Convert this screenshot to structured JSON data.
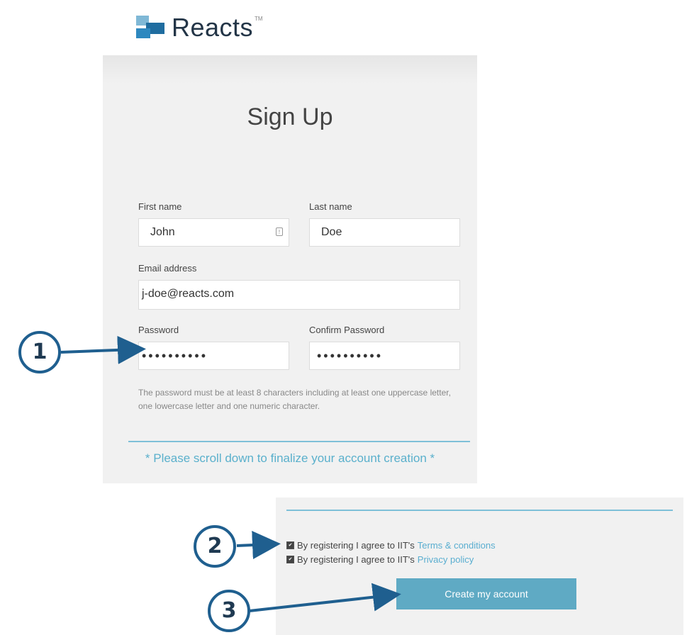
{
  "logo": {
    "name": "Reacts",
    "tm": "TM"
  },
  "form": {
    "title": "Sign Up",
    "first_name": {
      "label": "First name",
      "value": "John"
    },
    "last_name": {
      "label": "Last name",
      "value": "Doe"
    },
    "email": {
      "label": "Email address",
      "value": "j-doe@reacts.com"
    },
    "password": {
      "label": "Password",
      "value": "••••••••••"
    },
    "confirm_password": {
      "label": "Confirm Password",
      "value": "••••••••••"
    },
    "password_hint": "The password must be at least 8 characters including at least one uppercase letter, one lowercase letter and one numeric character.",
    "scroll_note": "* Please scroll down to finalize your account creation *"
  },
  "agreements": {
    "terms": {
      "text": "By registering I agree to IIT's",
      "link": "Terms & conditions",
      "checked": true
    },
    "privacy": {
      "text": "By registering I agree to IIT's",
      "link": "Privacy policy",
      "checked": true
    }
  },
  "create_button": "Create my account",
  "callouts": [
    "1",
    "2",
    "3"
  ],
  "colors": {
    "accent": "#5faac4",
    "link": "#5aaed0",
    "callout": "#1f5f8f",
    "panel": "#f1f1f1"
  },
  "icons": {
    "first_name_field": "contact-card-icon",
    "checkbox": "checkbox-checked-icon"
  }
}
